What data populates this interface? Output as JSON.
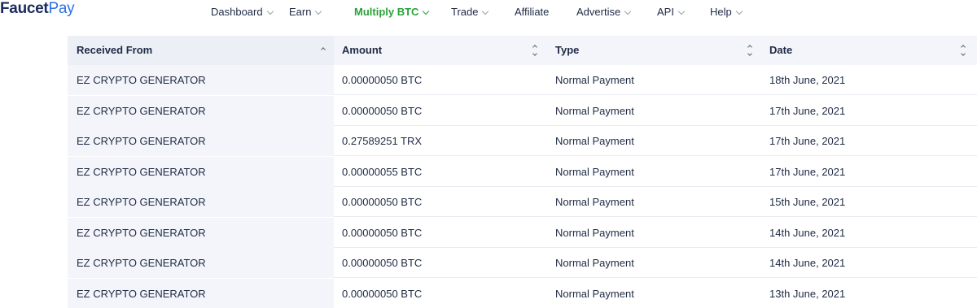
{
  "brand": {
    "part1": "Faucet",
    "part2": "Pay"
  },
  "nav": [
    {
      "label": "Dashboard",
      "dropdown": true
    },
    {
      "label": "Earn",
      "dropdown": true
    },
    {
      "label": "Multiply BTC",
      "dropdown": true,
      "active": true
    },
    {
      "label": "Trade",
      "dropdown": true
    },
    {
      "label": "Affiliate",
      "dropdown": false
    },
    {
      "label": "Advertise",
      "dropdown": true
    },
    {
      "label": "API",
      "dropdown": true
    },
    {
      "label": "Help",
      "dropdown": true
    }
  ],
  "colors": {
    "active_nav": "#2aa13a",
    "brand_dark": "#1a2b5e",
    "brand_blue": "#2b6fe8",
    "header_bg": "#f3f5fa"
  },
  "table": {
    "columns": [
      {
        "label": "Received From",
        "sort": "asc"
      },
      {
        "label": "Amount",
        "sort": "both"
      },
      {
        "label": "Type",
        "sort": "both"
      },
      {
        "label": "Date",
        "sort": "both"
      }
    ],
    "rows": [
      [
        "EZ CRYPTO GENERATOR",
        "0.00000050 BTC",
        "Normal Payment",
        "18th June, 2021"
      ],
      [
        "EZ CRYPTO GENERATOR",
        "0.00000050 BTC",
        "Normal Payment",
        "17th June, 2021"
      ],
      [
        "EZ CRYPTO GENERATOR",
        "0.27589251 TRX",
        "Normal Payment",
        "17th June, 2021"
      ],
      [
        "EZ CRYPTO GENERATOR",
        "0.00000055 BTC",
        "Normal Payment",
        "17th June, 2021"
      ],
      [
        "EZ CRYPTO GENERATOR",
        "0.00000050 BTC",
        "Normal Payment",
        "15th June, 2021"
      ],
      [
        "EZ CRYPTO GENERATOR",
        "0.00000050 BTC",
        "Normal Payment",
        "14th June, 2021"
      ],
      [
        "EZ CRYPTO GENERATOR",
        "0.00000050 BTC",
        "Normal Payment",
        "14th June, 2021"
      ],
      [
        "EZ CRYPTO GENERATOR",
        "0.00000050 BTC",
        "Normal Payment",
        "13th June, 2021"
      ]
    ]
  }
}
